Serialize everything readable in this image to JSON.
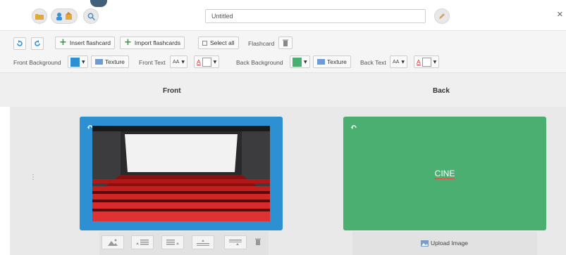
{
  "document": {
    "title": "Untitled"
  },
  "toolbar": {
    "insert_flashcard": "Insert flashcard",
    "import_flashcards": "Import flashcards",
    "select_all": "Select all",
    "flashcard_label": "Flashcard",
    "front_background": "Front Background",
    "texture": "Texture",
    "front_text": "Front Text",
    "back_background": "Back Background",
    "back_text": "Back Text",
    "font_size_glyph": "AA",
    "font_color_glyph": "A"
  },
  "colors": {
    "front_background": "#2d90d2",
    "back_background": "#4caf72",
    "front_text_color": "#ffffff",
    "back_text_color": "#ffffff"
  },
  "columns": {
    "front": "Front",
    "back": "Back"
  },
  "card": {
    "back_text": "CINE",
    "upload_image": "Upload Image"
  },
  "icons": [
    "folder-icon",
    "users-icon",
    "search-icon",
    "pencil-icon",
    "undo-icon",
    "redo-icon",
    "trash-icon",
    "rotate-icon",
    "image-icon",
    "align-left-icon",
    "align-right-icon",
    "align-bottom-icon",
    "align-top-icon"
  ]
}
